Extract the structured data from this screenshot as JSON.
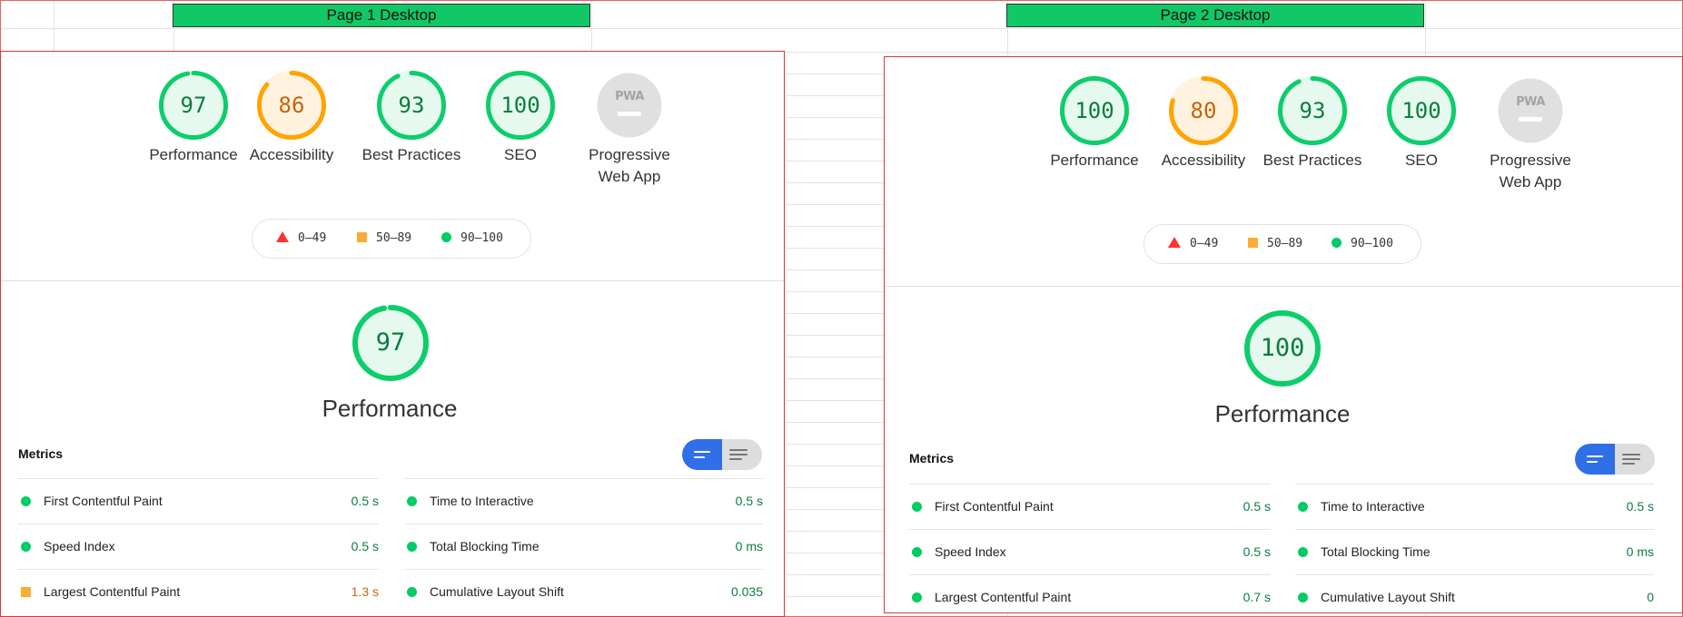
{
  "colors": {
    "pass": "#0cce6b",
    "average": "#ffa400",
    "fail": "#ff4e42",
    "pwa_gray": "#e0e0e0",
    "header_green": "#12c866",
    "border_red": "#d33b3b",
    "toggle_blue": "#2f6fe8"
  },
  "headers": [
    "Page 1 Desktop",
    "Page 2 Desktop"
  ],
  "reports": [
    {
      "gauges": [
        {
          "value": "97",
          "score": 0.97,
          "label": "Performance",
          "status": "pass"
        },
        {
          "value": "86",
          "score": 0.86,
          "label": "Accessibility",
          "status": "average"
        },
        {
          "value": "93",
          "score": 0.93,
          "label": "Best Practices",
          "status": "pass"
        },
        {
          "value": "100",
          "score": 1.0,
          "label": "SEO",
          "status": "pass"
        },
        {
          "value": "",
          "score": 0,
          "label": "Progressive Web App",
          "status": "pwa",
          "badge": "PWA"
        }
      ],
      "legend": {
        "fail": "0–49",
        "average": "50–89",
        "pass": "90–100"
      },
      "performance": {
        "score": "97",
        "score_frac": 0.97,
        "title": "Performance"
      },
      "metrics_title": "Metrics",
      "metrics_left": [
        {
          "name": "First Contentful Paint",
          "value": "0.5 s",
          "status": "pass"
        },
        {
          "name": "Speed Index",
          "value": "0.5 s",
          "status": "pass"
        },
        {
          "name": "Largest Contentful Paint",
          "value": "1.3 s",
          "status": "average"
        }
      ],
      "metrics_right": [
        {
          "name": "Time to Interactive",
          "value": "0.5 s",
          "status": "pass"
        },
        {
          "name": "Total Blocking Time",
          "value": "0 ms",
          "status": "pass"
        },
        {
          "name": "Cumulative Layout Shift",
          "value": "0.035",
          "status": "pass"
        }
      ]
    },
    {
      "gauges": [
        {
          "value": "100",
          "score": 1.0,
          "label": "Performance",
          "status": "pass"
        },
        {
          "value": "80",
          "score": 0.8,
          "label": "Accessibility",
          "status": "average"
        },
        {
          "value": "93",
          "score": 0.93,
          "label": "Best Practices",
          "status": "pass"
        },
        {
          "value": "100",
          "score": 1.0,
          "label": "SEO",
          "status": "pass"
        },
        {
          "value": "",
          "score": 0,
          "label": "Progressive Web App",
          "status": "pwa",
          "badge": "PWA"
        }
      ],
      "legend": {
        "fail": "0–49",
        "average": "50–89",
        "pass": "90–100"
      },
      "performance": {
        "score": "100",
        "score_frac": 1.0,
        "title": "Performance"
      },
      "metrics_title": "Metrics",
      "metrics_left": [
        {
          "name": "First Contentful Paint",
          "value": "0.5 s",
          "status": "pass"
        },
        {
          "name": "Speed Index",
          "value": "0.5 s",
          "status": "pass"
        },
        {
          "name": "Largest Contentful Paint",
          "value": "0.7 s",
          "status": "pass"
        }
      ],
      "metrics_right": [
        {
          "name": "Time to Interactive",
          "value": "0.5 s",
          "status": "pass"
        },
        {
          "name": "Total Blocking Time",
          "value": "0 ms",
          "status": "pass"
        },
        {
          "name": "Cumulative Layout Shift",
          "value": "0",
          "status": "pass"
        }
      ]
    }
  ]
}
